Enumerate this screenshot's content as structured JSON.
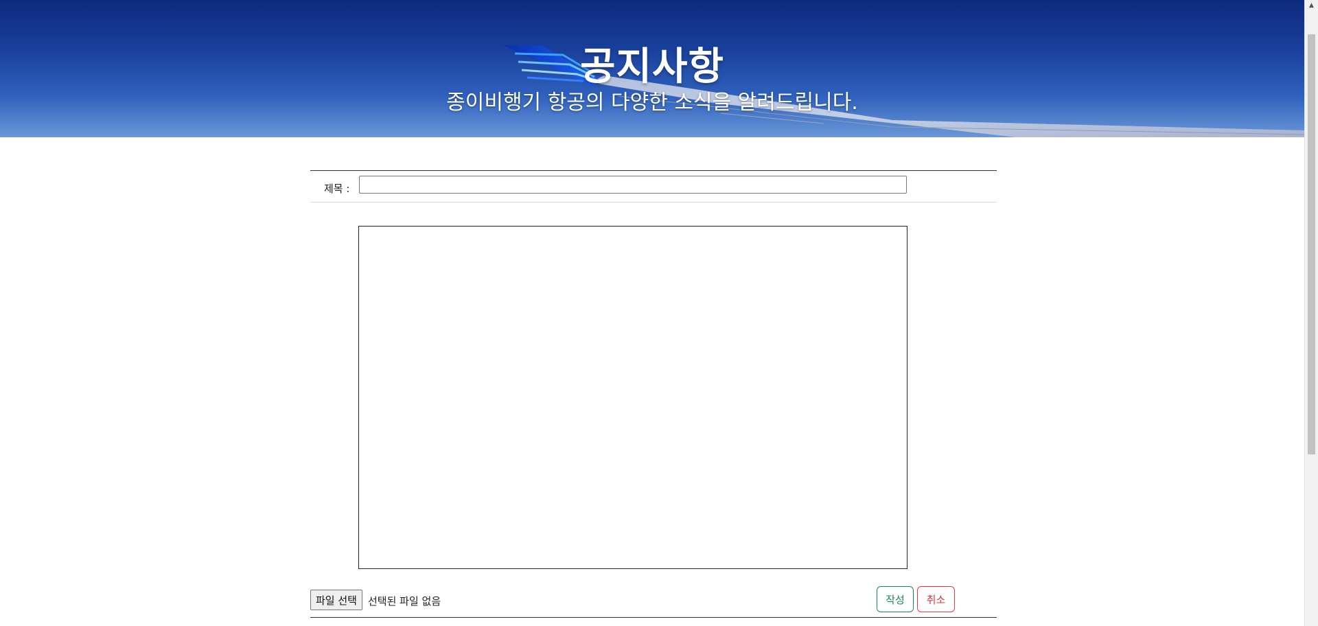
{
  "banner": {
    "title": "공지사항",
    "subtitle": "종이비행기 항공의 다양한 소식을 알려드립니다."
  },
  "form": {
    "title_label": "제목 :",
    "title_value": "",
    "content_value": "",
    "file_button_label": "파일 선택",
    "file_status": "선택된 파일 없음",
    "submit_label": "작성",
    "cancel_label": "취소"
  },
  "colors": {
    "submit": "#198754",
    "cancel": "#dc3545",
    "banner_sky": "#183f9a"
  },
  "icons": {
    "scroll_up": "caret-up-icon"
  }
}
